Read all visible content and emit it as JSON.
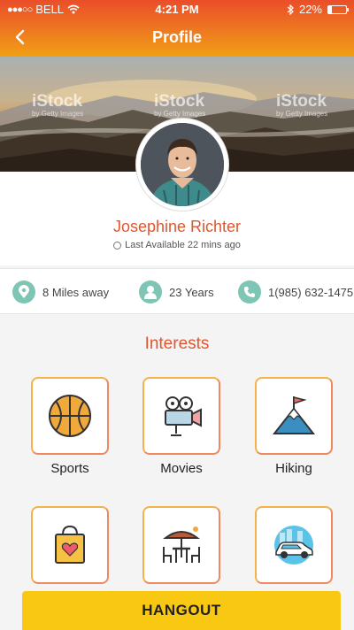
{
  "status_bar": {
    "carrier": "BELL",
    "time": "4:21 PM",
    "battery": "22%",
    "battery_level": 0.22
  },
  "nav": {
    "title": "Profile",
    "back_icon": "chevron-left-icon"
  },
  "cover": {
    "watermarks": [
      "iStock",
      "iStock",
      "iStock"
    ],
    "watermark_sub": "by Getty Images"
  },
  "profile": {
    "name": "Josephine Richter",
    "last_available": "Last Available 22 mins ago"
  },
  "info": [
    {
      "icon": "location-pin-icon",
      "text": "8 Miles away"
    },
    {
      "icon": "person-icon",
      "text": "23 Years"
    },
    {
      "icon": "phone-icon",
      "text": "1(985) 632-1475"
    }
  ],
  "interests": {
    "title": "Interests",
    "items": [
      {
        "label": "Sports",
        "icon": "basketball-icon"
      },
      {
        "label": "Movies",
        "icon": "film-projector-icon"
      },
      {
        "label": "Hiking",
        "icon": "mountain-flag-icon"
      },
      {
        "label": "",
        "icon": "shopping-bag-icon"
      },
      {
        "label": "",
        "icon": "outdoor-cafe-icon"
      },
      {
        "label": "",
        "icon": "car-icon"
      }
    ]
  },
  "cta": {
    "label": "HANGOUT"
  },
  "colors": {
    "accent": "#e0562f",
    "header_start": "#ea4e2a",
    "header_end": "#f0a014",
    "info_icon": "#7ec5b6",
    "cta": "#f9c812"
  }
}
